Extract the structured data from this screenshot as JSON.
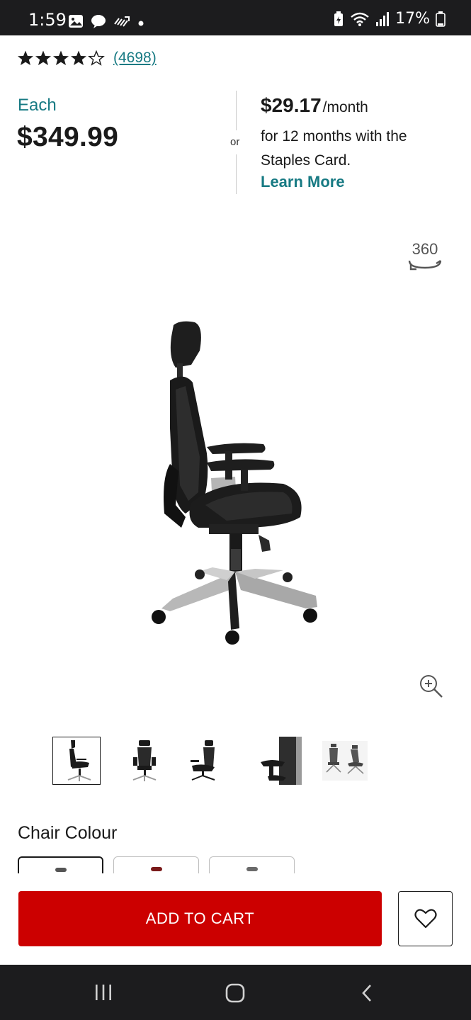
{
  "status_bar": {
    "time": "1:59",
    "battery": "17%",
    "left_icons": [
      "image-icon",
      "chat-bubble-icon",
      "missed-call-icon",
      "dot-icon"
    ],
    "right_icons": [
      "battery-saver-icon",
      "wifi-icon",
      "signal-icon",
      "battery-icon"
    ]
  },
  "rating": {
    "stars": 4,
    "max_stars": 5,
    "review_count": "(4698)"
  },
  "price": {
    "each_label": "Each",
    "amount": "$349.99",
    "or_label": "or",
    "monthly_amount": "$29.17",
    "monthly_unit": "/month",
    "finance_text": "for 12 months with the Staples Card.",
    "learn_more": "Learn More"
  },
  "media": {
    "view_360_label": "360",
    "thumbnails_count": 5,
    "selected_thumbnail": 0
  },
  "colour": {
    "label": "Chair Colour",
    "options": [
      {
        "color": "#555555",
        "selected": true
      },
      {
        "color": "#7a1a1a",
        "selected": false
      },
      {
        "color": "#6a6a6a",
        "selected": false
      }
    ]
  },
  "actions": {
    "add_to_cart": "ADD TO CART"
  },
  "colors": {
    "accent_teal": "#177a83",
    "cart_red": "#cc0000",
    "system_bar": "#1c1c1e"
  }
}
